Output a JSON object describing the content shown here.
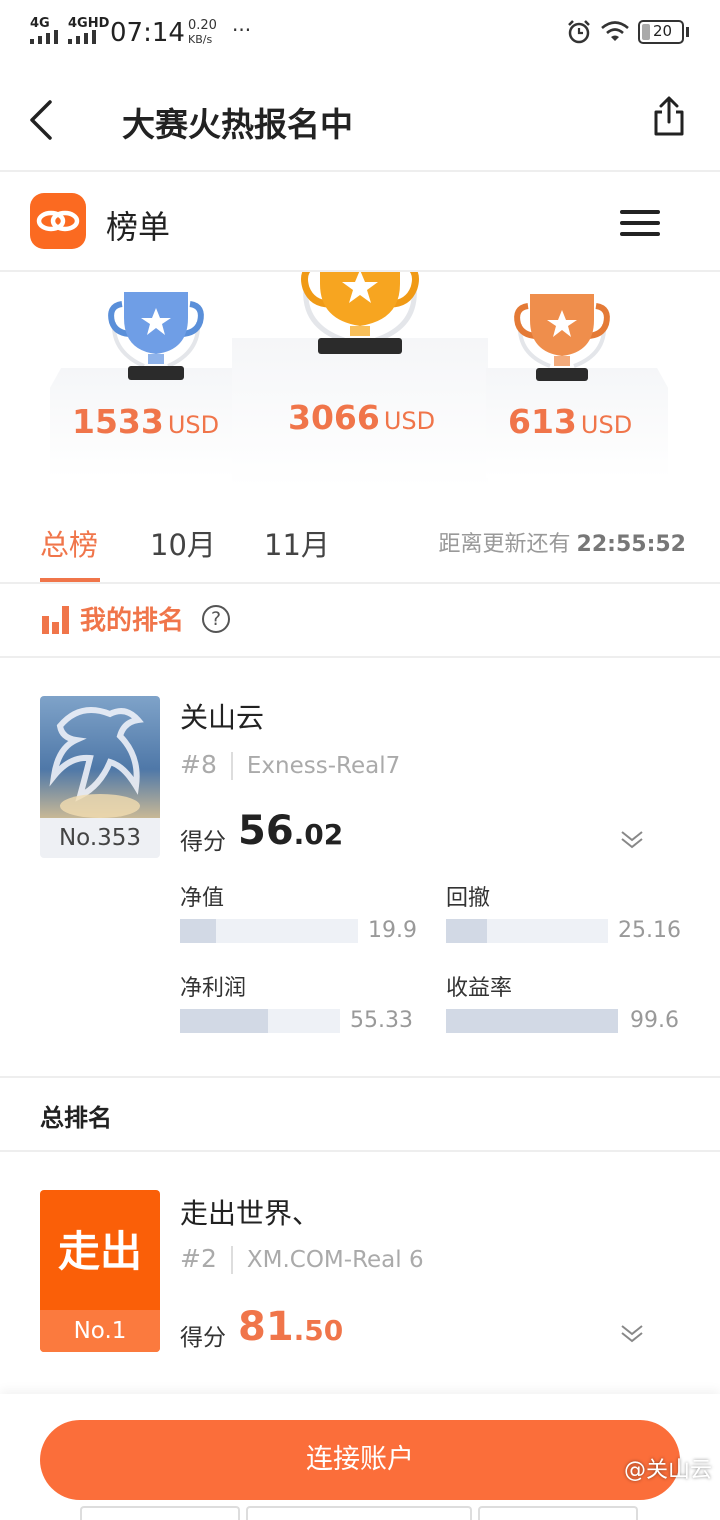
{
  "status_bar": {
    "signal1": "4G",
    "signal2": "4GHD",
    "time": "07:14",
    "speed_value": "0.20",
    "speed_unit": "KB/s",
    "more": "···",
    "battery": "20"
  },
  "nav": {
    "title": "大赛火热报名中"
  },
  "app_header": {
    "title": "榜单"
  },
  "podium": {
    "second": {
      "amount": "1533",
      "unit": "USD"
    },
    "first": {
      "amount": "3066",
      "unit": "USD"
    },
    "third": {
      "amount": "613",
      "unit": "USD"
    }
  },
  "tabs": {
    "items": [
      "总榜",
      "10月",
      "11月"
    ],
    "update_label": "距离更新还有",
    "update_time": "22:55:52"
  },
  "my_ranking": {
    "title": "我的排名",
    "help": "?",
    "name": "关山云",
    "rank": "#8",
    "account": "Exness-Real7",
    "badge": "No.353",
    "score_label": "得分",
    "score_int": "56",
    "score_dec": ".02",
    "stats": [
      {
        "label": "净值",
        "value": "19.9",
        "fill": 0.2
      },
      {
        "label": "回撤",
        "value": "25.16",
        "fill": 0.25
      },
      {
        "label": "净利润",
        "value": "55.33",
        "fill": 0.55
      },
      {
        "label": "收益率",
        "value": "99.6",
        "fill": 1.0
      }
    ]
  },
  "overall": {
    "title": "总排名",
    "entry": {
      "avatar_text": "走出",
      "badge": "No.1",
      "name": "走出世界、",
      "rank": "#2",
      "account": "XM.COM-Real 6",
      "score_label": "得分",
      "score_int": "81",
      "score_dec": ".50"
    }
  },
  "bottom": {
    "connect_label": "连接账户",
    "watermark": "@关山云"
  },
  "colors": {
    "accent": "#f0754a",
    "button": "#fb6e3a",
    "gold": "#f7a520",
    "silver": "#6f9ee6",
    "bronze": "#ef8e4c"
  }
}
